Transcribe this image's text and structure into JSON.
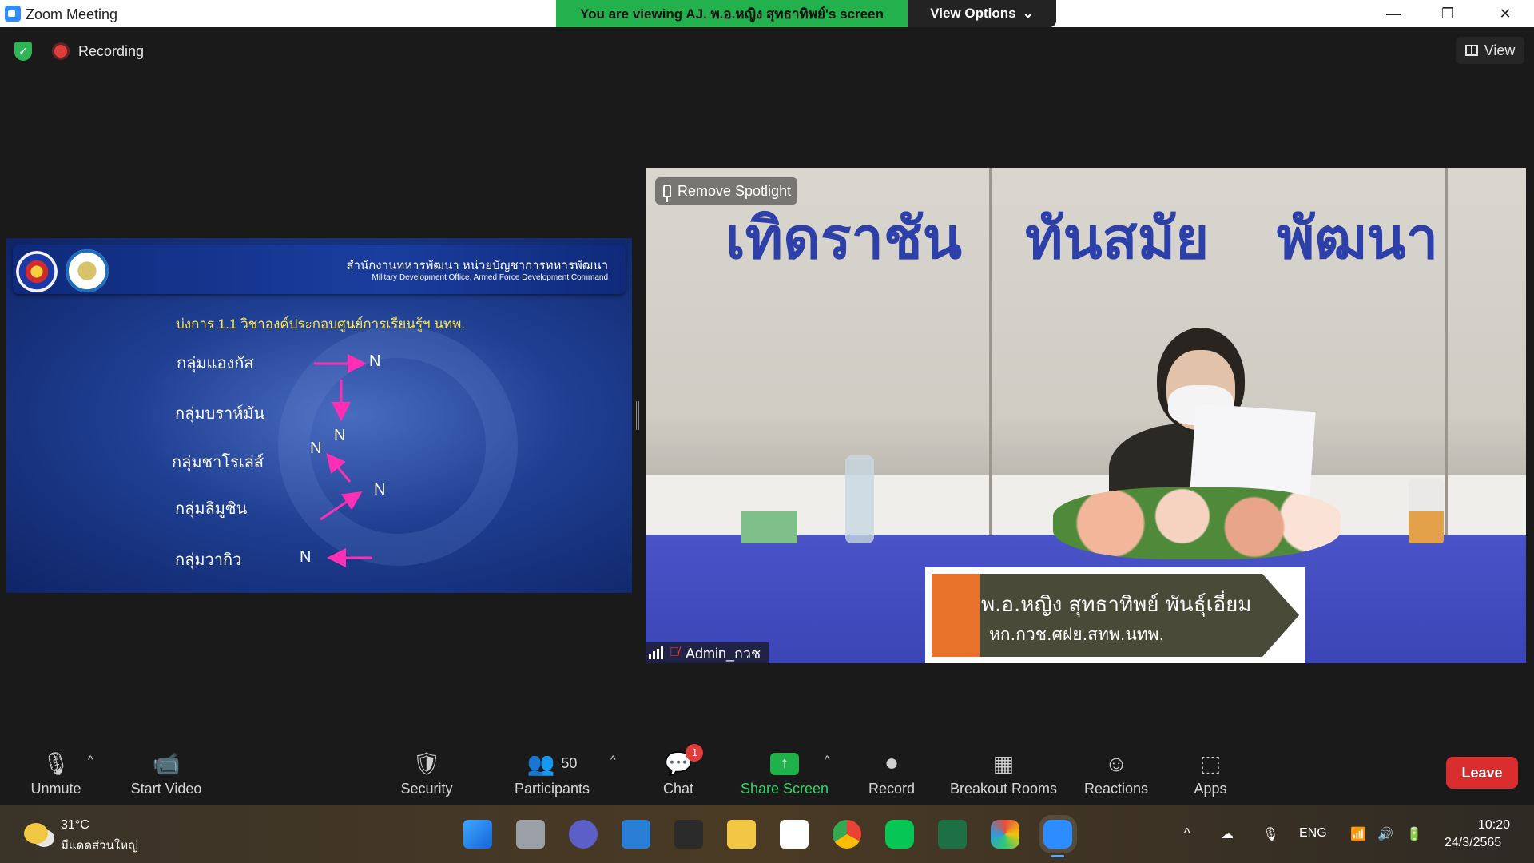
{
  "window": {
    "title": "Zoom Meeting",
    "viewing_banner": "You are viewing AJ. พ.อ.หญิง สุทธาทิพย์'s screen",
    "view_options": "View Options"
  },
  "topbar": {
    "recording_label": "Recording",
    "view_label": "View"
  },
  "slide": {
    "org_thai": "สำนักงานทหารพัฒนา  หน่วยบัญชาการทหารพัฒนา",
    "org_english": "Military Development Office, Armed Force Development Command",
    "heading": "บ่งการ 1.1 วิชาองค์ประกอบศูนย์การเรียนรู้ฯ นทพ.",
    "groups": [
      "กลุ่มแองกัส",
      "กลุ่มบราห์มัน",
      "กลุ่มชาโรเล่ส์",
      "กลุ่มลิมูซิน",
      "กลุ่มวากิว"
    ],
    "n_label": "N"
  },
  "video": {
    "remove_spotlight": "Remove Spotlight",
    "participant_name": "Admin_กวช",
    "backdrop_words": [
      "เทิดราชัน",
      "ทันสมัย",
      "พัฒนา"
    ],
    "nameplate_name": "พ.อ.หญิง สุทธาทิพย์  พันธุ์เอี่ยม",
    "nameplate_title": "หก.กวช.ศฝย.สทพ.นทพ."
  },
  "toolbar": {
    "unmute": "Unmute",
    "start_video": "Start Video",
    "security": "Security",
    "participants": "Participants",
    "participants_count": "50",
    "chat": "Chat",
    "chat_badge": "1",
    "share_screen": "Share Screen",
    "record": "Record",
    "breakout_rooms": "Breakout Rooms",
    "reactions": "Reactions",
    "apps": "Apps",
    "leave": "Leave"
  },
  "taskbar": {
    "temperature": "31°C",
    "weather": "มีแดดส่วนใหญ่",
    "language": "ENG",
    "time": "10:20",
    "date": "24/3/2565"
  },
  "colors": {
    "banner_green": "#22b14c",
    "share_green": "#1fb24a",
    "leave_red": "#d92d2d",
    "slide_blue": "#1f3f92",
    "arrow_pink": "#ff2fb5"
  }
}
